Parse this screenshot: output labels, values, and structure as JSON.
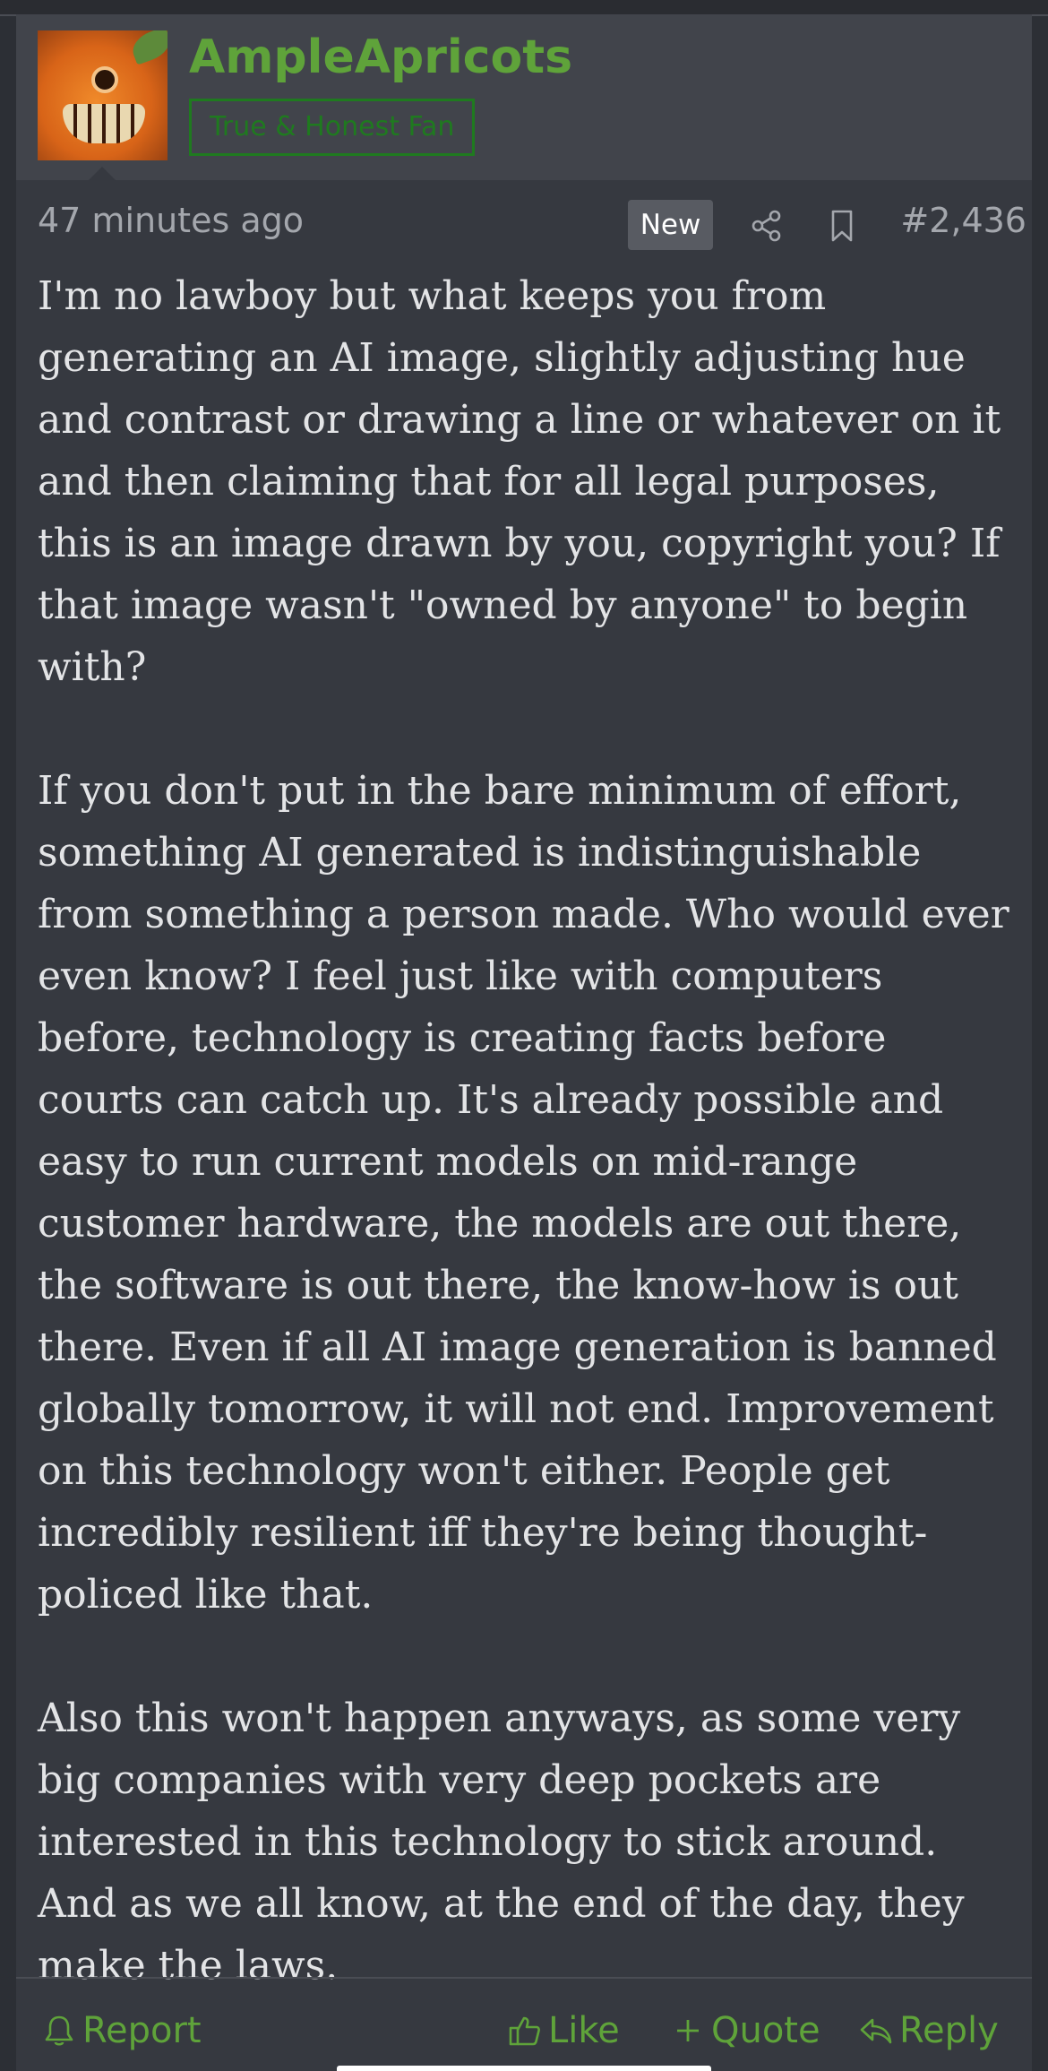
{
  "user": {
    "username": "AmpleApricots",
    "title": "True & Honest Fan",
    "avatar_icon": "apricot-monster-avatar"
  },
  "post": {
    "timestamp": "47 minutes ago",
    "new_badge": "New",
    "share_icon": "share-icon",
    "bookmark_icon": "bookmark-icon",
    "number": "#2,436",
    "paragraphs": [
      "I'm no lawboy but what keeps you from generating an AI image, slightly adjusting hue and contrast or drawing a line or whatever on it and then claiming that for all legal purposes, this is an image drawn by you, copyright you? If that image wasn't \"owned by anyone\" to begin with?",
      "If you don't put in the bare minimum of effort, something AI generated is indistinguishable from something a person made. Who would ever even know? I feel just like with computers before, technology is creating facts before courts can catch up. It's already possible and easy to run current models on mid-range customer hardware, the models are out there, the software is out there, the know-how is out there. Even if all AI image generation is banned globally tomorrow, it will not end. Improvement on this technology won't either. People get incredibly resilient iff they're being thought-policed like that.",
      "Also this won't happen anyways, as some very big companies with very deep pockets are interested in this technology to stick around. And as we all know, at the end of the day, they make the laws."
    ]
  },
  "actions": {
    "report": "Report",
    "like": "Like",
    "quote": "Quote",
    "reply": "Reply"
  },
  "colors": {
    "accent_green": "#5fa33a",
    "title_green": "#1f7a1f",
    "background": "#363940",
    "header_background": "#41444b",
    "text": "#e3e4e6",
    "muted_text": "#a4a7ad"
  }
}
